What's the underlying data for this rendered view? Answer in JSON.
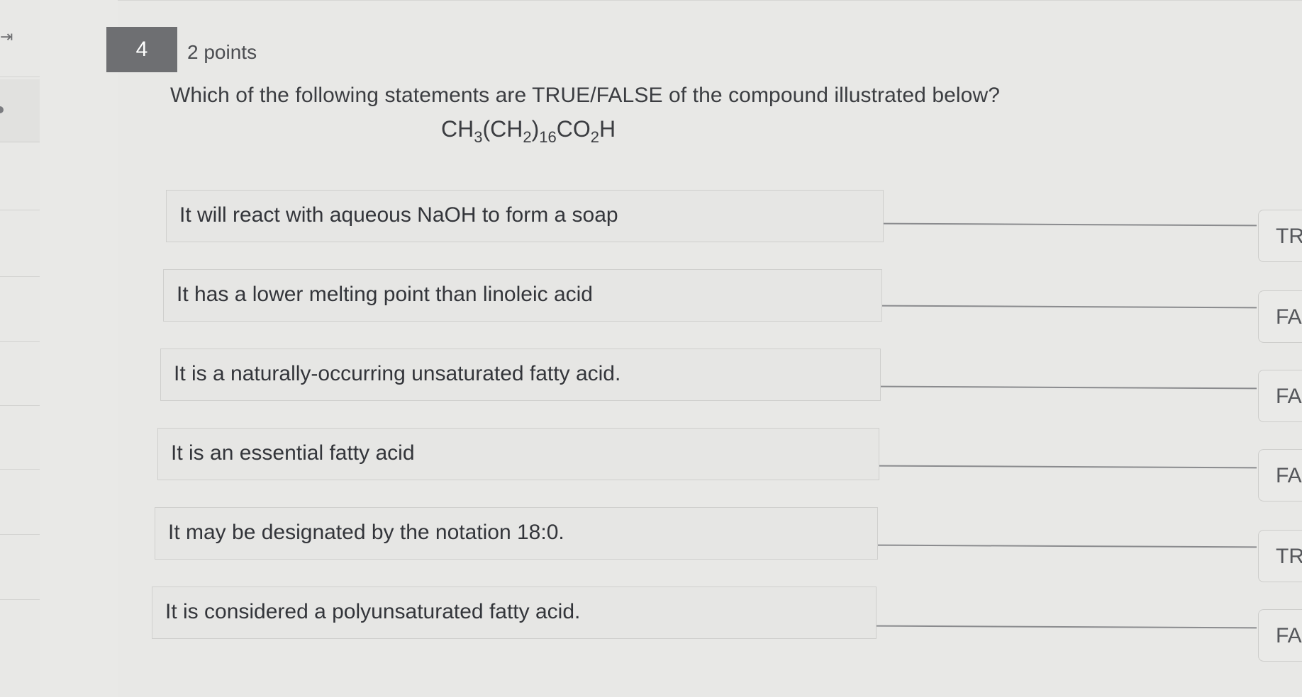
{
  "question": {
    "number": "4",
    "points": "2 points",
    "text": "Which of the following statements are TRUE/FALSE of the compound illustrated below?",
    "formula": {
      "p1": "CH",
      "s1": "3",
      "p2": "(CH",
      "s2": "2",
      "p3": ")",
      "s3": "16",
      "p4": "CO",
      "s4": "2",
      "p5": "H"
    }
  },
  "rail": {
    "toggle_icon": "collapse-arrow-icon"
  },
  "statements": [
    {
      "text": "It will react with aqueous NaOH to form a soap",
      "answer": "TR"
    },
    {
      "text": "It has a lower melting point than linoleic acid",
      "answer": "FA"
    },
    {
      "text": "It is a naturally-occurring unsaturated fatty acid.",
      "answer": "FA"
    },
    {
      "text": "It is an essential fatty acid",
      "answer": "FA"
    },
    {
      "text": "It may be designated by the notation 18:0.",
      "answer": "TR"
    },
    {
      "text": "It is considered a polyunsaturated fatty acid.",
      "answer": "FA"
    }
  ]
}
